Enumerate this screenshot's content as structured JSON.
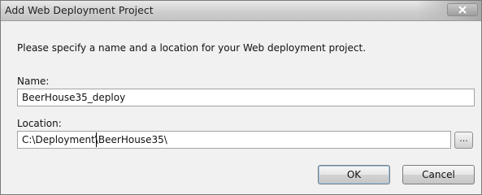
{
  "window": {
    "title": "Add Web Deployment Project",
    "close_icon": "close-icon"
  },
  "dialog": {
    "instruction": "Please specify a name and a location for your Web deployment project.",
    "name_label": "Name:",
    "name_value": "BeerHouse35_deploy",
    "location_label": "Location:",
    "location_value": "C:\\Deployment\\BeerHouse35\\",
    "browse_label": "...",
    "ok_label": "OK",
    "cancel_label": "Cancel"
  }
}
